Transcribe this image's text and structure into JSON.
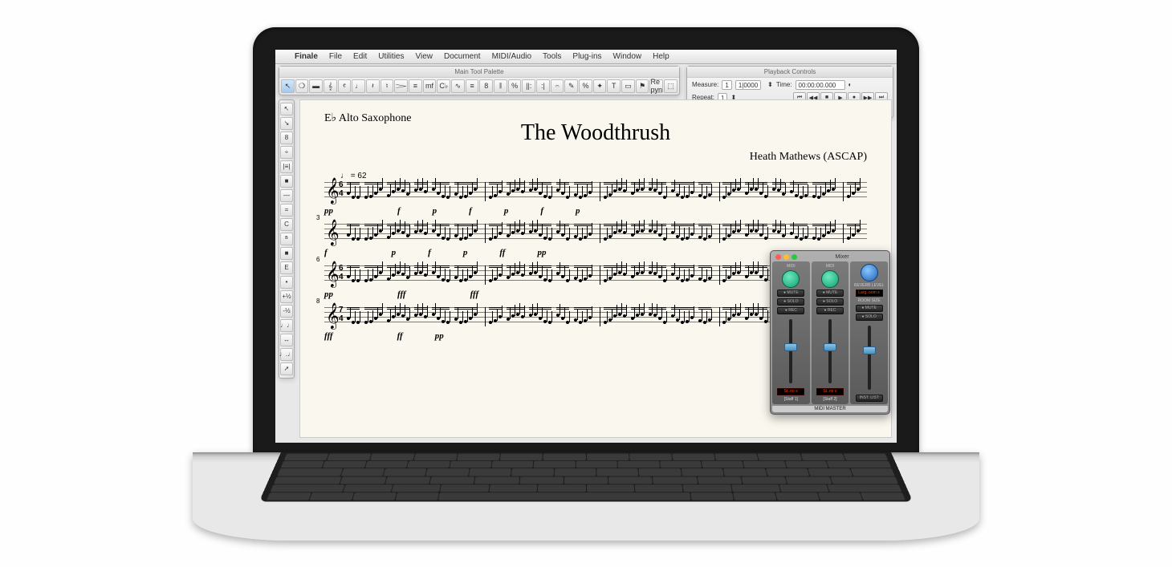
{
  "menubar": {
    "app": "Finale",
    "items": [
      "File",
      "Edit",
      "Utilities",
      "View",
      "Document",
      "MIDI/Audio",
      "Tools",
      "Plug-ins",
      "Window",
      "Help"
    ]
  },
  "tool_palette": {
    "title": "Main Tool Palette",
    "tools": [
      "↖",
      "❍",
      "▬",
      "𝄞",
      "𝄴",
      "♩",
      "𝄽",
      "♮",
      "𝆓",
      "≡",
      "mf",
      "C♭",
      "∿",
      "≡",
      "8",
      "𝄂",
      "%",
      "||:",
      ":|",
      "𝄐",
      "✎",
      "%",
      "✦",
      "T",
      "▭",
      "⚑",
      "Re\npyn",
      "⬚"
    ]
  },
  "side_tools": [
    "↖",
    "↘",
    "8",
    "÷",
    "|≡|",
    "■",
    "—",
    "=",
    "C",
    "ᴮ",
    "■",
    "E",
    "•",
    "+½",
    "-½",
    "♩♩",
    "↔",
    "♩.♩",
    "➚"
  ],
  "playback": {
    "title": "Playback Controls",
    "measure_label": "Measure:",
    "measure_val": "1",
    "pos_val": "1|0000",
    "time_label": "Time:",
    "time_val": "00:00:00.000",
    "repeat_label": "Repeat:",
    "repeat_val": "1",
    "transport": [
      "⏮",
      "◀◀",
      "■",
      "▶",
      "●",
      "▶▶",
      "⏭"
    ]
  },
  "score": {
    "instrument": "E♭ Alto Saxophone",
    "title": "The Woodthrush",
    "composer": "Heath Mathews (ASCAP)",
    "tempo": "♩ = 62",
    "time_sig_top": "6",
    "time_sig_bot": "4",
    "systems": [
      {
        "measure": "",
        "dynamics": [
          "pp",
          "",
          "f",
          "p",
          "f",
          "p",
          "f",
          "p"
        ]
      },
      {
        "measure": "3",
        "dynamics": [
          "f",
          "",
          "p",
          "f",
          "p",
          "ff",
          "pp"
        ]
      },
      {
        "measure": "6",
        "time_top": "6",
        "time_bot": "4",
        "dynamics": [
          "pp",
          "",
          "fff",
          "",
          "fff"
        ]
      },
      {
        "measure": "8",
        "time_top": "7",
        "time_bot": "4",
        "dynamics": [
          "fff",
          "",
          "ff",
          "pp"
        ]
      }
    ]
  },
  "mixer": {
    "title": "Mixer",
    "channels": [
      {
        "knob_label": "MIDI",
        "buttons": [
          "MUTE",
          "SOLO",
          "REC"
        ],
        "display": "St..no ≡",
        "name": "[Staff 1]",
        "fader": 30
      },
      {
        "knob_label": "MIDI",
        "buttons": [
          "MUTE",
          "SOLO",
          "REC"
        ],
        "display": "St..no ≡",
        "name": "[Staff 2]",
        "fader": 30
      }
    ],
    "master": {
      "knob_label": "REVERB LEVEL",
      "display1": "Larg..oom ≡",
      "label2": "ROOM SIZE",
      "buttons": [
        "MUTE",
        "SOLO"
      ],
      "inst_btn": "INST. LIST",
      "name": "MIDI MASTER",
      "fader": 26
    }
  }
}
